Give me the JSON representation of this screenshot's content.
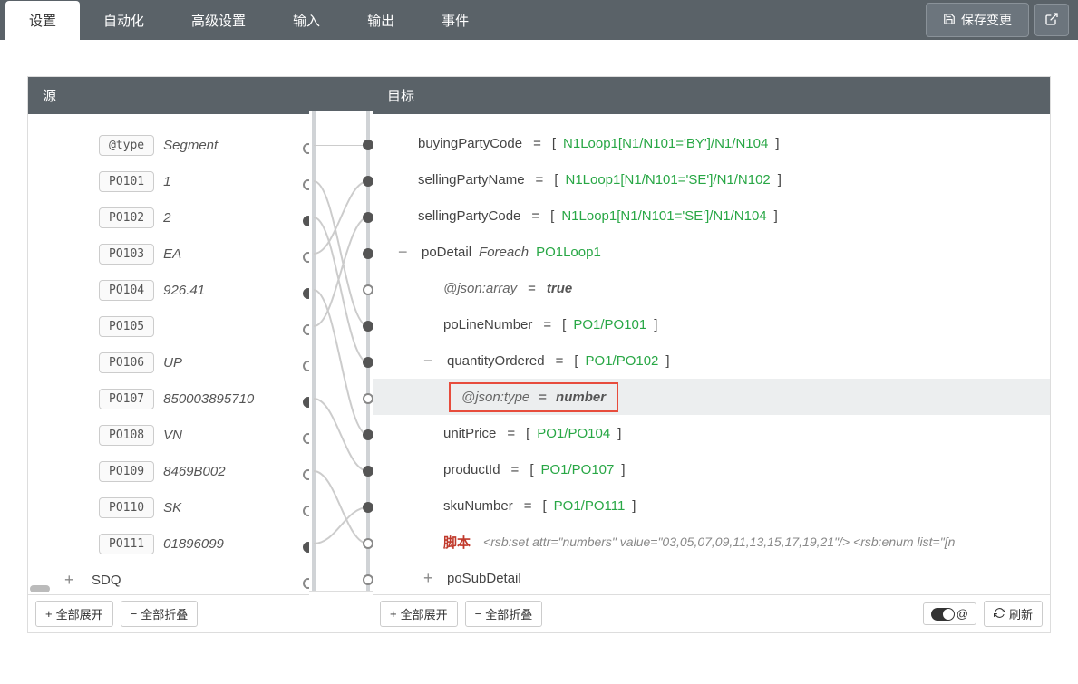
{
  "tabs": {
    "settings": "设置",
    "automation": "自动化",
    "advanced": "高级设置",
    "input": "输入",
    "output": "输出",
    "events": "事件"
  },
  "buttons": {
    "save_changes": "保存变更",
    "expand_all": "全部展开",
    "collapse_all": "全部折叠",
    "refresh": "刷新",
    "toggle_at": "@"
  },
  "panel_headers": {
    "source": "源",
    "target": "目标"
  },
  "source_rows": [
    {
      "badge": "@type",
      "value": "Segment",
      "indent": true
    },
    {
      "badge": "PO101",
      "value": "1",
      "indent": true
    },
    {
      "badge": "PO102",
      "value": "2",
      "indent": true
    },
    {
      "badge": "PO103",
      "value": "EA",
      "indent": true
    },
    {
      "badge": "PO104",
      "value": "926.41",
      "indent": true
    },
    {
      "badge": "PO105",
      "value": "",
      "indent": true
    },
    {
      "badge": "PO106",
      "value": "UP",
      "indent": true
    },
    {
      "badge": "PO107",
      "value": "850003895710",
      "indent": true
    },
    {
      "badge": "PO108",
      "value": "VN",
      "indent": true
    },
    {
      "badge": "PO109",
      "value": "8469B002",
      "indent": true
    },
    {
      "badge": "PO110",
      "value": "SK",
      "indent": true
    },
    {
      "badge": "PO111",
      "value": "01896099",
      "indent": true
    }
  ],
  "source_collapsed": {
    "expander": "+",
    "label": "SDQ"
  },
  "target_rows": {
    "buyingPartyCode": {
      "name": "buyingPartyCode",
      "path": "N1Loop1[N1/N101='BY']/N1/N104"
    },
    "sellingPartyName": {
      "name": "sellingPartyName",
      "path": "N1Loop1[N1/N101='SE']/N1/N102"
    },
    "sellingPartyCode": {
      "name": "sellingPartyCode",
      "path": "N1Loop1[N1/N101='SE']/N1/N104"
    },
    "poDetail": {
      "name": "poDetail",
      "keyword": "Foreach",
      "path": "PO1Loop1"
    },
    "jsonArray": {
      "attr": "@json:array",
      "value": "true"
    },
    "poLineNumber": {
      "name": "poLineNumber",
      "path": "PO1/PO101"
    },
    "quantityOrdered": {
      "name": "quantityOrdered",
      "path": "PO1/PO102"
    },
    "jsonType": {
      "attr": "@json:type",
      "value": "number"
    },
    "unitPrice": {
      "name": "unitPrice",
      "path": "PO1/PO104"
    },
    "productId": {
      "name": "productId",
      "path": "PO1/PO107"
    },
    "skuNumber": {
      "name": "skuNumber",
      "path": "PO1/PO111"
    },
    "script": {
      "label": "脚本",
      "body": "<rsb:set attr=\"numbers\" value=\"03,05,07,09,11,13,15,17,19,21\"/> <rsb:enum list=\"[n"
    },
    "poSubDetail": {
      "name": "poSubDetail"
    }
  },
  "expand_collapse_icons": {
    "minus": "−",
    "plus": "+"
  }
}
